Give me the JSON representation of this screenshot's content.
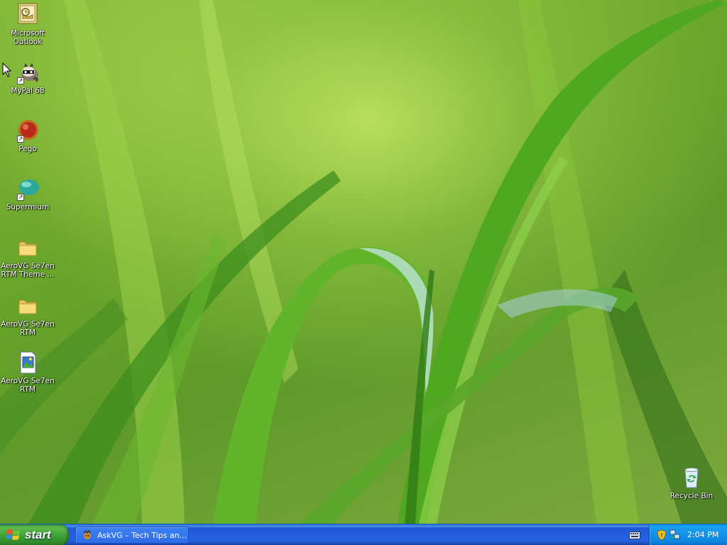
{
  "desktop": {
    "icons": [
      {
        "label": "Microsoft Outlook",
        "icon": "outlook-icon"
      },
      {
        "label": "MyPal 68",
        "icon": "mypal-raccoon-icon",
        "shortcut": true
      },
      {
        "label": "Pego",
        "icon": "pego-icon",
        "shortcut": true
      },
      {
        "label": "Supermium",
        "icon": "supermium-icon",
        "shortcut": true
      },
      {
        "label": "AeroVG Se7en RTM Theme ...",
        "icon": "folder-icon"
      },
      {
        "label": "AeroVG Se7en RTM",
        "icon": "folder-icon"
      },
      {
        "label": "AeroVG Se7en RTM",
        "icon": "image-file-icon"
      },
      {
        "label": "Recycle Bin",
        "icon": "recycle-bin-icon"
      }
    ]
  },
  "taskbar": {
    "start_label": "start",
    "tasks": [
      {
        "label": "AskVG – Tech Tips an...",
        "icon": "askvg-icon"
      }
    ],
    "tray": {
      "clock": "2:04 PM",
      "icons": [
        "security-shield-icon",
        "network-icon"
      ]
    },
    "language_icon": "keyboard-icon"
  },
  "colors": {
    "taskbar_blue": "#2663e0",
    "start_green": "#3a9d34",
    "tray_blue": "#0f86e0",
    "wallpaper_green": "#6aa52b"
  }
}
